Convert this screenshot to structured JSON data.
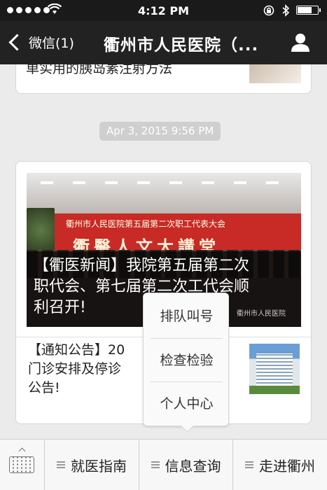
{
  "status_bar": {
    "time": "4:12 PM",
    "battery_level": 0.65,
    "icons": [
      "signal-dots-icon",
      "wifi-icon",
      "orientation-lock-icon",
      "bluetooth-icon",
      "battery-icon"
    ]
  },
  "nav": {
    "back_label": "微信(1)",
    "title": "衢州市人民医院（...",
    "icons": [
      "chevron-left-icon",
      "user-icon"
    ]
  },
  "messages": {
    "top_card_text": "单实用的胰岛素注射方法",
    "timestamp": "Apr 3, 2015 9:56 PM",
    "news": {
      "banner_caption_lines": [
        "【衢医新闻】我院第五届第二次",
        "职代会、第七届第二次工代会顺",
        "利召开!"
      ],
      "banner_sign_line1": "衢州市人民医院第五届第二次职工代表大会",
      "banner_sign_line2": "衢醫人文大講堂",
      "banner_watermark": "衢州市人民医院",
      "item2_lines": [
        "【通知公告】20",
        "门诊安排及停诊",
        "公告!"
      ]
    }
  },
  "popup_menu": {
    "items": [
      "排队叫号",
      "检查检验",
      "个人中心"
    ]
  },
  "bottom_bar": {
    "keyboard_icon": "keyboard-icon",
    "tabs": [
      "就医指南",
      "信息查询",
      "走进衢州"
    ]
  }
}
